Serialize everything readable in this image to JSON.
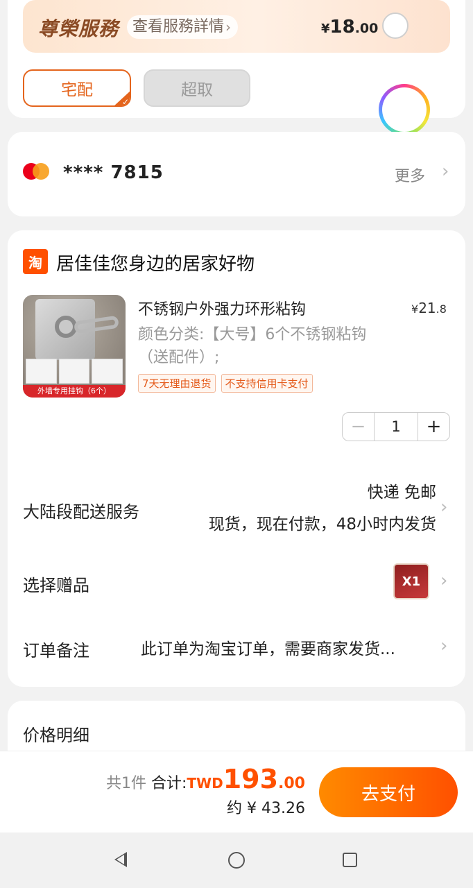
{
  "service": {
    "title": "尊榮服務",
    "link": "查看服務詳情",
    "price_currency": "¥",
    "price_int": "18",
    "price_dec": ".00"
  },
  "delivery": {
    "options": [
      "宅配",
      "超取"
    ],
    "selected": "宅配"
  },
  "payment": {
    "card_number": "**** 7815",
    "more": "更多"
  },
  "shop": {
    "logo_text": "淘",
    "name": "居佳佳您身边的居家好物"
  },
  "product": {
    "title": "不锈钢户外强力环形粘钩",
    "price_currency": "¥",
    "price_int": "21",
    "price_dec": ".8",
    "sku": "颜色分类:【大号】6个不锈钢粘钩（送配件）;",
    "image_caption": "外墙专用挂钩（6个）",
    "tags": [
      "7天无理由退货",
      "不支持信用卡支付"
    ],
    "quantity": "1"
  },
  "shipping": {
    "label": "大陆段配送服务",
    "method": "快递 免邮",
    "detail": "现货，现在付款，48小时内发货"
  },
  "gift": {
    "label": "选择赠品",
    "count": "X1"
  },
  "note": {
    "label": "订单备注",
    "text": "此订单为淘宝订单，需要商家发货..."
  },
  "price_detail": {
    "title": "价格明细"
  },
  "total": {
    "count_text": "共1件",
    "label": "合计:",
    "currency": "TWD",
    "amount_int": "193",
    "amount_dec": ".00",
    "approx": "约 ¥ 43.26"
  },
  "pay_button": "去支付",
  "colors": {
    "accent": "#ff5000",
    "delivery_selected": "#e4641c"
  }
}
